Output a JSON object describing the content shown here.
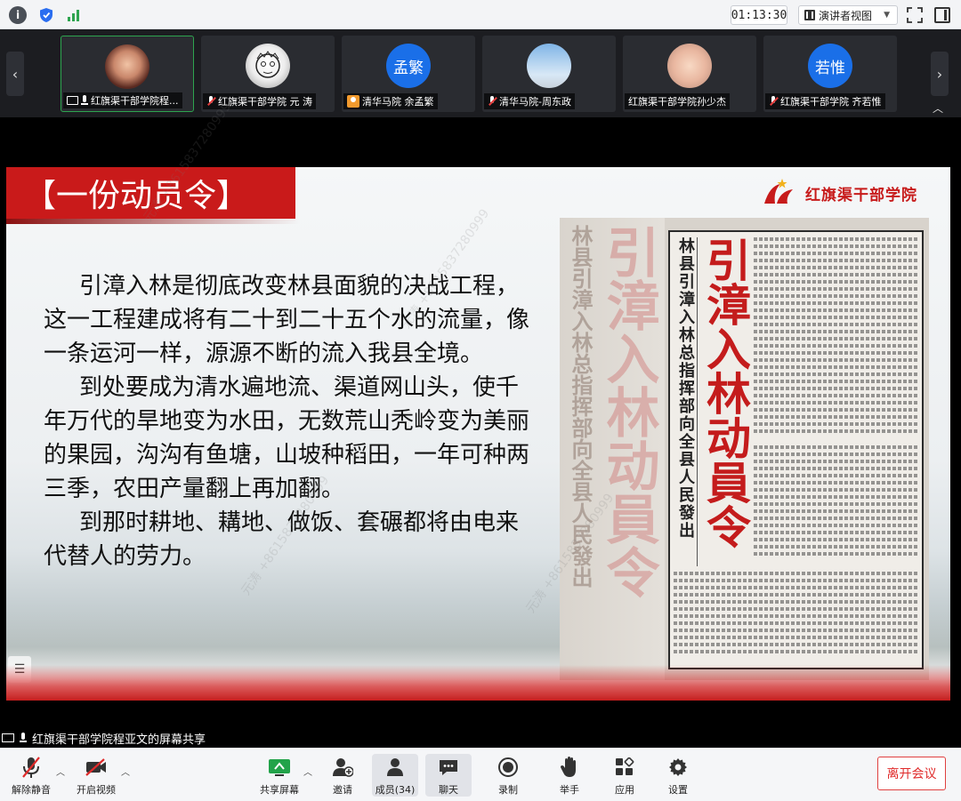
{
  "topbar": {
    "timer": "01:13:30",
    "view_mode": "演讲者视图"
  },
  "participants": [
    {
      "name": "红旗渠干部学院程...",
      "avatar": "photo",
      "mic": "on",
      "sharing": true,
      "active": true
    },
    {
      "name": "红旗渠干部学院 元 涛",
      "avatar": "photo",
      "mic": "off"
    },
    {
      "name": "清华马院 余孟繁",
      "avatar_text": "孟繁",
      "mic": "none"
    },
    {
      "name": "清华马院-周东政",
      "avatar": "photo",
      "mic": "off"
    },
    {
      "name": "红旗渠干部学院孙少杰",
      "avatar": "photo",
      "mic": "none"
    },
    {
      "name": "红旗渠干部学院 齐若惟",
      "avatar_text": "若惟",
      "mic": "off"
    }
  ],
  "slide": {
    "title": "【一份动员令】",
    "logo_text": "红旗渠干部学院",
    "paragraphs": [
      "引漳入林是彻底改变林县面貌的决战工程，这一工程建成将有二十到二十五个水的流量，像一条运河一样，源源不断的流入我县全境。",
      "到处要成为清水遍地流、渠道网山头，使千年万代的旱地变为水田，无数荒山秃岭变为美丽的果园，沟沟有鱼塘，山坡种稻田，一年可种两三季，农田产量翻上再加翻。",
      "到那时耕地、耩地、做饭、套碾都将由电来代替人的劳力。"
    ],
    "newspaper": {
      "headline": "引漳入林动員令",
      "subhead": "林县引漳入林总指挥部向全县人民發出",
      "ghost_sub": "林县引漳入林总指挥部向全县人民發出",
      "ghost_head": "引漳入林动員令"
    }
  },
  "share_status": "红旗渠干部学院程亚文的屏幕共享",
  "toolbar": {
    "unmute": "解除静音",
    "start_video": "开启视频",
    "share_screen": "共享屏幕",
    "invite": "邀请",
    "members": "成员(34)",
    "chat": "聊天",
    "record": "录制",
    "raise_hand": "举手",
    "apps": "应用",
    "settings": "设置",
    "leave": "离开会议"
  },
  "colors": {
    "accent_red": "#c91a1a",
    "avatar_blue": "#1a6fe8",
    "active_green": "#2ea44f"
  }
}
